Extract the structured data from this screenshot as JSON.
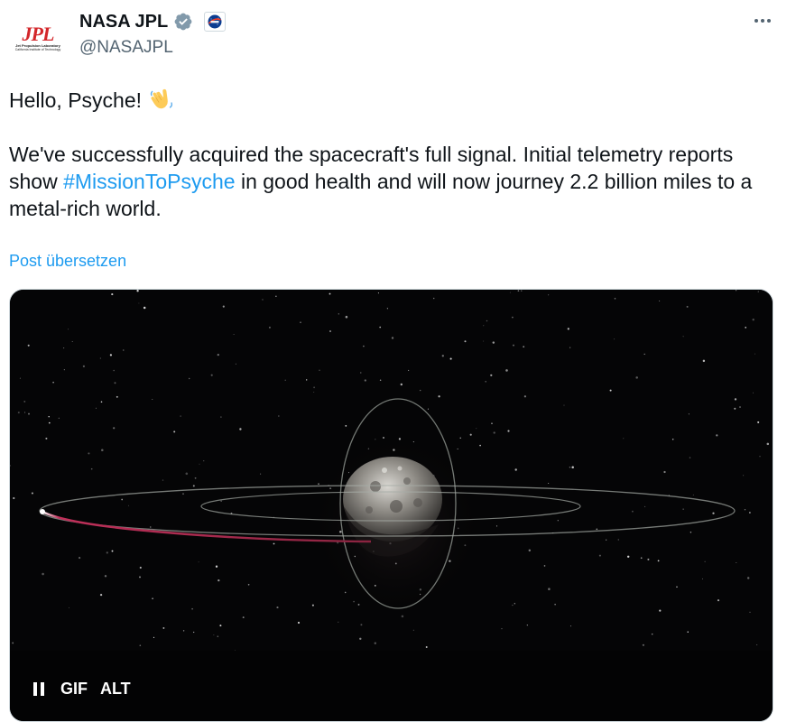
{
  "author": {
    "avatar_logo": "JPL",
    "avatar_line1": "Jet Propulsion Laboratory",
    "avatar_line2": "California Institute of Technology",
    "display_name": "NASA JPL",
    "handle": "@NASAJPL",
    "verified_icon": "verified-badge-icon",
    "affiliate_icon": "nasa-logo-icon"
  },
  "tweet": {
    "line1_text": "Hello, Psyche! ",
    "line1_emoji": "waving-hand-emoji",
    "para2_before": "We've successfully acquired the spacecraft's full signal. Initial telemetry reports show ",
    "hashtag": "#MissionToPsyche",
    "para2_after": " in good health and will now journey 2.2 billion miles to a metal-rich world.",
    "translate_label": "Post übersetzen"
  },
  "media": {
    "gif_label": "GIF",
    "alt_label": "ALT",
    "pause_icon": "pause-icon"
  },
  "colors": {
    "link": "#1d9bf0",
    "text": "#0f1419",
    "secondary": "#536471",
    "jpl_red": "#d3262a",
    "trajectory": "#c0305a"
  }
}
